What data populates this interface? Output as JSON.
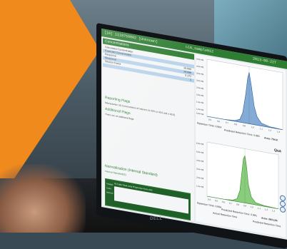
{
  "titlebar": {
    "left": "[10]  1118750802  [Unknown]",
    "center": "LCA_sample012",
    "right": "2013-08-22T"
  },
  "concentrations": {
    "header": "Concentrations",
    "rows": [
      {
        "label": "Calculated Concentration",
        "value": "",
        "highlight": false
      },
      {
        "label": "Expected Concentration",
        "value": "",
        "highlight": true
      },
      {
        "label": "Response",
        "value": "26.066",
        "highlight": false
      },
      {
        "label": "Response",
        "value": "26.066",
        "highlight": true
      },
      {
        "label": "Dilution Factor",
        "value": "0.172",
        "highlight": false
      },
      {
        "label": "",
        "value": "1",
        "highlight": true
      }
    ]
  },
  "reporting_flags": {
    "title": "Reporting Flags",
    "text": "Manipulation  (d)       Concentration of Interest 14.20% (± 40.0 and ± 40.0)"
  },
  "additional_flags": {
    "title": "Additional Flags",
    "text": "There are no additional flags"
  },
  "normalization": {
    "title": "Normalization (Internal Standard)",
    "subtitle": "Internal Standard(IS)",
    "columns": "IS Code   Peak area   Response   Area ratio",
    "row_labels": [
      "Analyte",
      "Code",
      "Internal"
    ]
  },
  "chart_top": {
    "yticks": [
      "4.5e+05",
      "4.0e+05",
      "3.5e+05",
      "3.0e+05",
      "2.5e+05",
      "2.0e+05",
      "1.5e+05",
      "1.0e+05",
      "5.0e+04"
    ],
    "xticks": [
      "0.5",
      "0.6",
      "0.7",
      "0.8",
      "0.9",
      "1.0",
      "1.1",
      "1.2",
      "1.3"
    ],
    "retention": "Retention Time: 0.864",
    "predicted": "Predicted Retention Time: 0.881",
    "area": "Area: 754.8"
  },
  "chart_bottom": {
    "title": "Qua",
    "yticks": [
      "6.0e+03",
      "5.0e+03",
      "4.0e+03",
      "3.0e+03",
      "2.0e+03",
      "1.0e+03"
    ],
    "xticks": [
      "0.4",
      "0.5",
      "0.6",
      "0.7",
      "0.8",
      "0.9",
      "1.0",
      "1.1",
      "1.2",
      "1.3"
    ],
    "retention": "Retention Time: 0.866",
    "predicted": "Predicted Retention Time: 0.881",
    "area": "Area: 384.126",
    "actual_label": "Actual Retention Time",
    "predicted_label": "Predicted Retention Time"
  },
  "colors": {
    "orange": "#f08a1c",
    "green": "#2e7d32",
    "blue_peak": "#5b8fc7",
    "green_peak": "#6bbf5b"
  },
  "brand": "DELL"
}
